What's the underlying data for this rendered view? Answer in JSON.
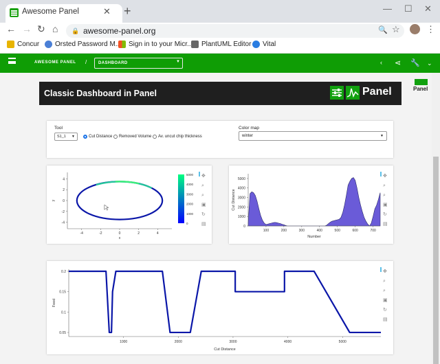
{
  "browser": {
    "tab_title": "Awesome Panel",
    "url": "awesome-panel.org",
    "bookmarks": [
      "Concur",
      "Orsted Password M...",
      "Sign in to your Micr...",
      "PlantUML Editor",
      "Vital"
    ]
  },
  "appbar": {
    "brand": "AWESOME PANEL",
    "separator": "/",
    "page_select": "DASHBOARD"
  },
  "header": {
    "title": "Classic Dashboard in Panel",
    "logo_text": "Panel",
    "side_logo_text": "Panel"
  },
  "widgets": {
    "tool_label": "Tool",
    "tool_value": "S1_1",
    "radio_options": [
      "Cut Distance",
      "Removed Volume",
      "Av. uncut chip thickness"
    ],
    "radio_selected": 0,
    "colormap_label": "Color map",
    "colormap_value": "winter"
  },
  "colors": {
    "brand_green": "#0f9d05",
    "header_bg": "#1f1f1f",
    "line_blue": "#0a16a8",
    "hist_fill": "#6a5bd8"
  },
  "chart_data": [
    {
      "type": "scatter",
      "title": "",
      "xlabel": "x",
      "ylabel": "y",
      "xlim": [
        -5.5,
        5.5
      ],
      "ylim": [
        -5.2,
        5.2
      ],
      "x_ticks": [
        "-4",
        "-2",
        "0",
        "2",
        "4"
      ],
      "y_ticks": [
        "4",
        "2",
        "0",
        "-2",
        "-4"
      ],
      "shape": "ellipse",
      "center": [
        0,
        0
      ],
      "radii": [
        4.5,
        3.5
      ],
      "colorbar_ticks": [
        "5000",
        "4000",
        "3000",
        "2000",
        "1000",
        "0"
      ],
      "colorbar_range": [
        0,
        5000
      ],
      "colormap": "winter"
    },
    {
      "type": "area",
      "title": "",
      "xlabel": "Number",
      "ylabel": "Cut Distance",
      "xlim": [
        0,
        740
      ],
      "ylim": [
        0,
        5500
      ],
      "x_ticks": [
        "100",
        "200",
        "300",
        "400",
        "500",
        "600",
        "700"
      ],
      "y_ticks": [
        "5000",
        "4000",
        "3000",
        "2000",
        "1000",
        "0"
      ],
      "x": [
        0,
        10,
        20,
        30,
        40,
        50,
        60,
        70,
        80,
        90,
        100,
        110,
        120,
        130,
        140,
        150,
        160,
        170,
        180,
        190,
        200,
        210,
        220,
        430,
        440,
        450,
        460,
        470,
        480,
        490,
        500,
        510,
        520,
        530,
        540,
        550,
        560,
        570,
        580,
        590,
        600,
        610,
        620,
        630,
        640,
        650,
        660,
        670,
        680,
        690,
        700,
        710,
        720,
        730,
        740
      ],
      "values": [
        300,
        3400,
        3600,
        3500,
        3200,
        2600,
        1800,
        1100,
        600,
        300,
        150,
        200,
        250,
        300,
        350,
        380,
        350,
        300,
        250,
        180,
        120,
        50,
        0,
        0,
        80,
        250,
        400,
        500,
        550,
        600,
        650,
        700,
        900,
        1400,
        2200,
        3200,
        4300,
        4700,
        5000,
        5100,
        4800,
        4000,
        3000,
        2200,
        1500,
        900,
        500,
        200,
        0,
        300,
        1000,
        1800,
        2200,
        2800,
        3500
      ]
    },
    {
      "type": "line",
      "title": "",
      "xlabel": "Cut Distance",
      "ylabel": "Feed",
      "xlim": [
        0,
        5700
      ],
      "ylim": [
        0.04,
        0.205
      ],
      "x_ticks": [
        "1000",
        "2000",
        "3000",
        "4000",
        "5000"
      ],
      "y_ticks": [
        "0.2",
        "0.15",
        "0.1",
        "0.05"
      ],
      "x": [
        0,
        680,
        740,
        780,
        800,
        860,
        1710,
        1850,
        2220,
        2420,
        3040,
        3040,
        3940,
        3940,
        4480,
        5130,
        5700
      ],
      "values": [
        0.2,
        0.2,
        0.05,
        0.05,
        0.15,
        0.2,
        0.2,
        0.05,
        0.05,
        0.2,
        0.2,
        0.15,
        0.15,
        0.2,
        0.2,
        0.05,
        0.05
      ]
    }
  ]
}
